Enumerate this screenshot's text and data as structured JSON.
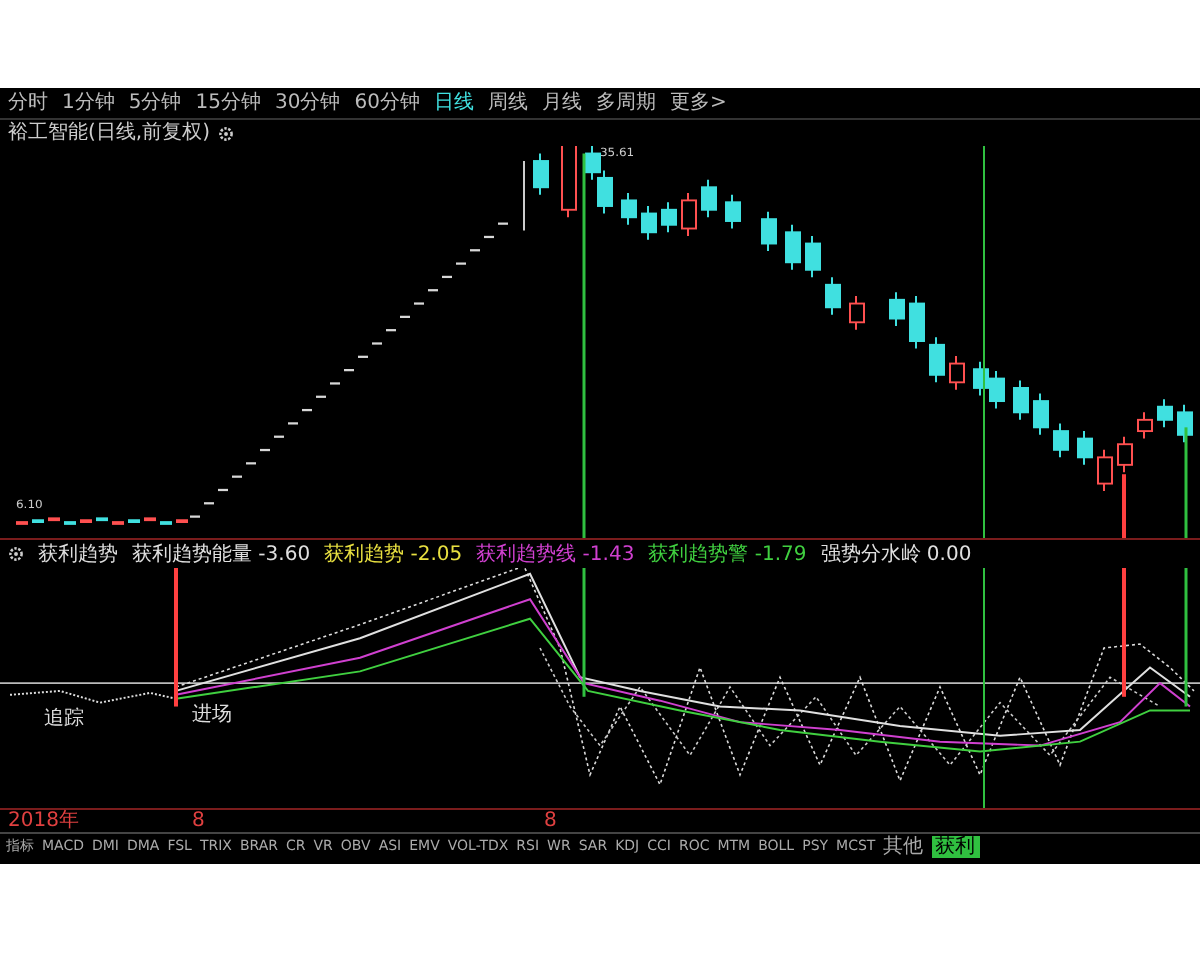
{
  "period_tabs": [
    {
      "label": "分时",
      "selected": false
    },
    {
      "label": "1分钟",
      "selected": false
    },
    {
      "label": "5分钟",
      "selected": false
    },
    {
      "label": "15分钟",
      "selected": false
    },
    {
      "label": "30分钟",
      "selected": false
    },
    {
      "label": "60分钟",
      "selected": false
    },
    {
      "label": "日线",
      "selected": true
    },
    {
      "label": "周线",
      "selected": false
    },
    {
      "label": "月线",
      "selected": false
    },
    {
      "label": "多周期",
      "selected": false
    },
    {
      "label": "更多>",
      "selected": false
    }
  ],
  "chart_title": "裕工智能(日线,前复权)",
  "main_chart": {
    "high_label": "35.61",
    "low_label": "6.10"
  },
  "indicator": {
    "name": "获利趋势",
    "legend": [
      {
        "name": "获利趋势能量",
        "value": "-3.60",
        "color": "#e0e0e0"
      },
      {
        "name": "获利趋势",
        "value": "-2.05",
        "color": "#e8e040"
      },
      {
        "name": "获利趋势线",
        "value": "-1.43",
        "color": "#d040d0"
      },
      {
        "name": "获利趋势警",
        "value": "-1.79",
        "color": "#40d040"
      },
      {
        "name": "强势分水岭",
        "value": "0.00",
        "color": "#e0e0e0"
      }
    ],
    "signals": [
      {
        "label": "追踪"
      },
      {
        "label": "进场"
      }
    ]
  },
  "axis_labels": [
    "2018年",
    "8",
    "8"
  ],
  "indicator_tabs": [
    {
      "label": "指标",
      "selected": false
    },
    {
      "label": "MACD",
      "selected": false
    },
    {
      "label": "DMI",
      "selected": false
    },
    {
      "label": "DMA",
      "selected": false
    },
    {
      "label": "FSL",
      "selected": false
    },
    {
      "label": "TRIX",
      "selected": false
    },
    {
      "label": "BRAR",
      "selected": false
    },
    {
      "label": "CR",
      "selected": false
    },
    {
      "label": "VR",
      "selected": false
    },
    {
      "label": "OBV",
      "selected": false
    },
    {
      "label": "ASI",
      "selected": false
    },
    {
      "label": "EMV",
      "selected": false
    },
    {
      "label": "VOL-TDX",
      "selected": false
    },
    {
      "label": "RSI",
      "selected": false
    },
    {
      "label": "WR",
      "selected": false
    },
    {
      "label": "SAR",
      "selected": false
    },
    {
      "label": "KDJ",
      "selected": false
    },
    {
      "label": "CCI",
      "selected": false
    },
    {
      "label": "ROC",
      "selected": false
    },
    {
      "label": "MTM",
      "selected": false
    },
    {
      "label": "BOLL",
      "selected": false
    },
    {
      "label": "PSY",
      "selected": false
    },
    {
      "label": "MCST",
      "selected": false
    },
    {
      "label": "其他",
      "selected": false
    },
    {
      "label": "获利",
      "selected": true
    }
  ]
}
